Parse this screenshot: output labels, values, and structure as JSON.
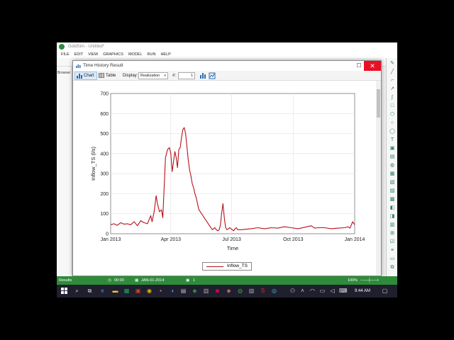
{
  "app": {
    "title": "GoldSim - Untitled*",
    "menu": [
      "FILE",
      "EDIT",
      "VIEW",
      "GRAPHICS",
      "MODEL",
      "RUN",
      "HELP"
    ],
    "browser_label": "Browser",
    "status": {
      "mode": "Results",
      "time": "00:00",
      "date": "JAN-01-2014",
      "realization": "1",
      "zoom": "100%"
    }
  },
  "dialog": {
    "title": "Time History Result",
    "maximize_glyph": "☐",
    "close_glyph": "✕",
    "toolbar": {
      "chart_label": "Chart",
      "table_label": "Table",
      "display_label": "Display:",
      "display_value": "Realization",
      "hash_label": "#:",
      "realization_value": "1"
    }
  },
  "chart_data": {
    "type": "line",
    "ylabel": "Inflow_TS (l/s)",
    "xlabel": "Time",
    "x_ticks": [
      "Jan 2013",
      "Apr 2013",
      "Jul 2013",
      "Oct 2013",
      "Jan 2014"
    ],
    "y_ticks": [
      0,
      100,
      200,
      300,
      400,
      500,
      600,
      700
    ],
    "ylim": [
      0,
      700
    ],
    "grid": true,
    "legend_position": "bottom",
    "colors": {
      "series": "#b5111b"
    },
    "series": [
      {
        "name": "Inflow_TS",
        "x_days": [
          0,
          5,
          10,
          15,
          20,
          25,
          30,
          35,
          40,
          45,
          50,
          55,
          60,
          62,
          65,
          68,
          70,
          73,
          76,
          78,
          80,
          82,
          85,
          88,
          90,
          92,
          94,
          96,
          98,
          100,
          102,
          104,
          106,
          108,
          110,
          112,
          114,
          116,
          118,
          120,
          122,
          124,
          126,
          128,
          130,
          132,
          134,
          136,
          138,
          140,
          142,
          144,
          146,
          148,
          150,
          152,
          154,
          156,
          158,
          160,
          162,
          164,
          166,
          168,
          170,
          172,
          174,
          176,
          178,
          180,
          182,
          184,
          186,
          188,
          190,
          195,
          200,
          210,
          220,
          230,
          240,
          250,
          260,
          270,
          280,
          290,
          300,
          305,
          310,
          320,
          330,
          340,
          350,
          355,
          358,
          362,
          365
        ],
        "values": [
          45,
          50,
          42,
          55,
          48,
          50,
          45,
          60,
          40,
          65,
          55,
          50,
          90,
          60,
          110,
          190,
          150,
          110,
          120,
          80,
          230,
          380,
          420,
          430,
          400,
          310,
          360,
          410,
          380,
          330,
          420,
          430,
          480,
          520,
          530,
          500,
          440,
          370,
          320,
          290,
          250,
          230,
          200,
          180,
          150,
          120,
          110,
          100,
          90,
          80,
          70,
          60,
          50,
          40,
          30,
          20,
          25,
          30,
          20,
          15,
          18,
          40,
          100,
          150,
          80,
          30,
          20,
          25,
          30,
          25,
          20,
          15,
          25,
          30,
          20,
          20,
          22,
          25,
          30,
          25,
          30,
          28,
          35,
          30,
          25,
          32,
          40,
          28,
          30,
          30,
          25,
          28,
          30,
          35,
          28,
          60,
          45
        ]
      }
    ]
  },
  "taskbar": {
    "clock": "9:44 AM"
  }
}
